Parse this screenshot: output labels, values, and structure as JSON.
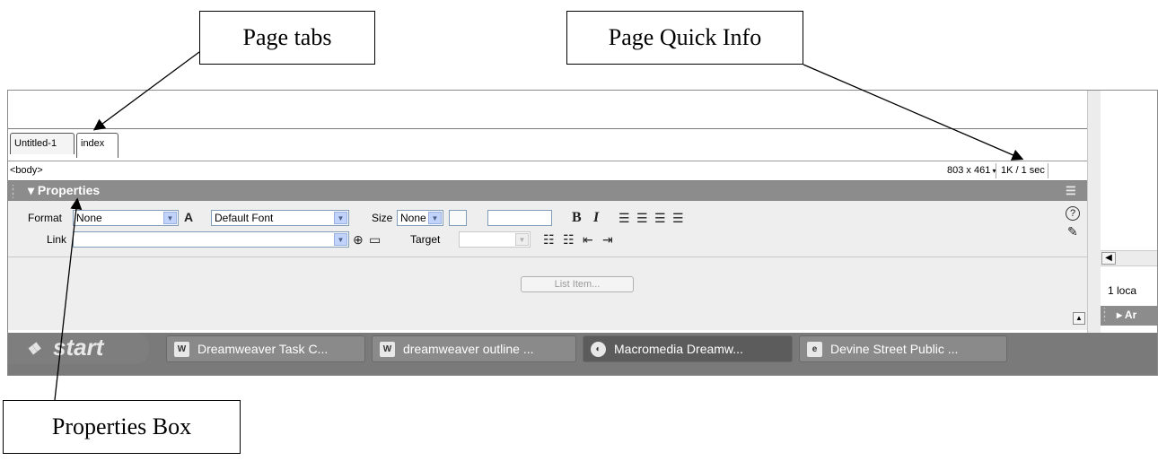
{
  "annotations": {
    "page_tabs": "Page tabs",
    "page_quick_info": "Page Quick Info",
    "properties_box": "Properties Box"
  },
  "document": {
    "tabs": [
      {
        "label": "Untitled-1",
        "active": false
      },
      {
        "label": "index",
        "active": true
      }
    ],
    "tag_selector": "<body>",
    "window_size": "803 x 461",
    "download_info": "1K / 1 sec"
  },
  "properties": {
    "title": "Properties",
    "format_label": "Format",
    "format_value": "None",
    "font_value": "Default Font",
    "size_label": "Size",
    "size_value": "None",
    "link_label": "Link",
    "link_value": "",
    "target_label": "Target",
    "target_value": "",
    "list_item_button": "List Item..."
  },
  "right_panel": {
    "local_text": "1 loca",
    "anim_label": "▸ Ar"
  },
  "taskbar": {
    "start_label": "start",
    "tasks": [
      {
        "label": "Dreamweaver Task C...",
        "icon": "word-doc-icon",
        "active": false
      },
      {
        "label": "dreamweaver outline ...",
        "icon": "word-doc-icon",
        "active": false
      },
      {
        "label": "Macromedia Dreamw...",
        "icon": "dreamweaver-icon",
        "active": true
      },
      {
        "label": "Devine Street Public ...",
        "icon": "browser-icon",
        "active": false
      }
    ]
  }
}
